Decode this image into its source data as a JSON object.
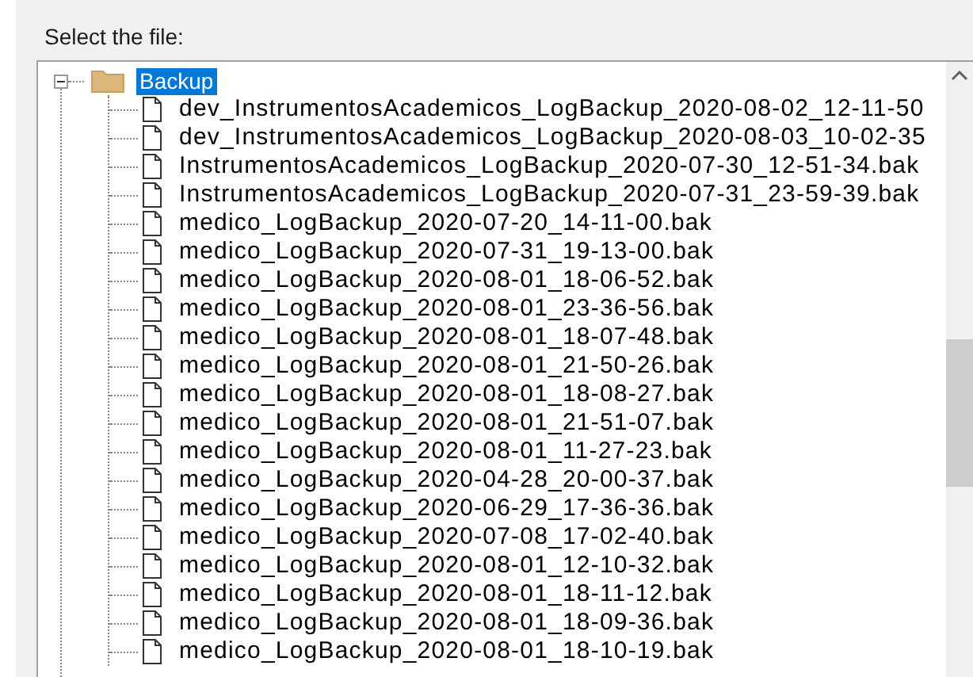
{
  "label": "Select the file:",
  "tree": {
    "label": "Backup",
    "expanded": true,
    "selected": true,
    "children": [
      {
        "label": "dev_InstrumentosAcademicos_LogBackup_2020-08-02_12-11-50",
        "selected": false
      },
      {
        "label": "dev_InstrumentosAcademicos_LogBackup_2020-08-03_10-02-35",
        "selected": false
      },
      {
        "label": "InstrumentosAcademicos_LogBackup_2020-07-30_12-51-34.bak",
        "selected": false
      },
      {
        "label": "InstrumentosAcademicos_LogBackup_2020-07-31_23-59-39.bak",
        "selected": false
      },
      {
        "label": "medico_LogBackup_2020-07-20_14-11-00.bak",
        "selected": false
      },
      {
        "label": "medico_LogBackup_2020-07-31_19-13-00.bak",
        "selected": false
      },
      {
        "label": "medico_LogBackup_2020-08-01_18-06-52.bak",
        "selected": false
      },
      {
        "label": "medico_LogBackup_2020-08-01_23-36-56.bak",
        "selected": false
      },
      {
        "label": "medico_LogBackup_2020-08-01_18-07-48.bak",
        "selected": false
      },
      {
        "label": "medico_LogBackup_2020-08-01_21-50-26.bak",
        "selected": false
      },
      {
        "label": "medico_LogBackup_2020-08-01_18-08-27.bak",
        "selected": false
      },
      {
        "label": "medico_LogBackup_2020-08-01_21-51-07.bak",
        "selected": false
      },
      {
        "label": "medico_LogBackup_2020-08-01_11-27-23.bak",
        "selected": false
      },
      {
        "label": "medico_LogBackup_2020-04-28_20-00-37.bak",
        "selected": false
      },
      {
        "label": "medico_LogBackup_2020-06-29_17-36-36.bak",
        "selected": false
      },
      {
        "label": "medico_LogBackup_2020-07-08_17-02-40.bak",
        "selected": false
      },
      {
        "label": "medico_LogBackup_2020-08-01_12-10-32.bak",
        "selected": false
      },
      {
        "label": "medico_LogBackup_2020-08-01_18-11-12.bak",
        "selected": false
      },
      {
        "label": "medico_LogBackup_2020-08-01_18-09-36.bak",
        "selected": false
      },
      {
        "label": "medico_LogBackup_2020-08-01_18-10-19.bak",
        "selected": false
      }
    ]
  }
}
